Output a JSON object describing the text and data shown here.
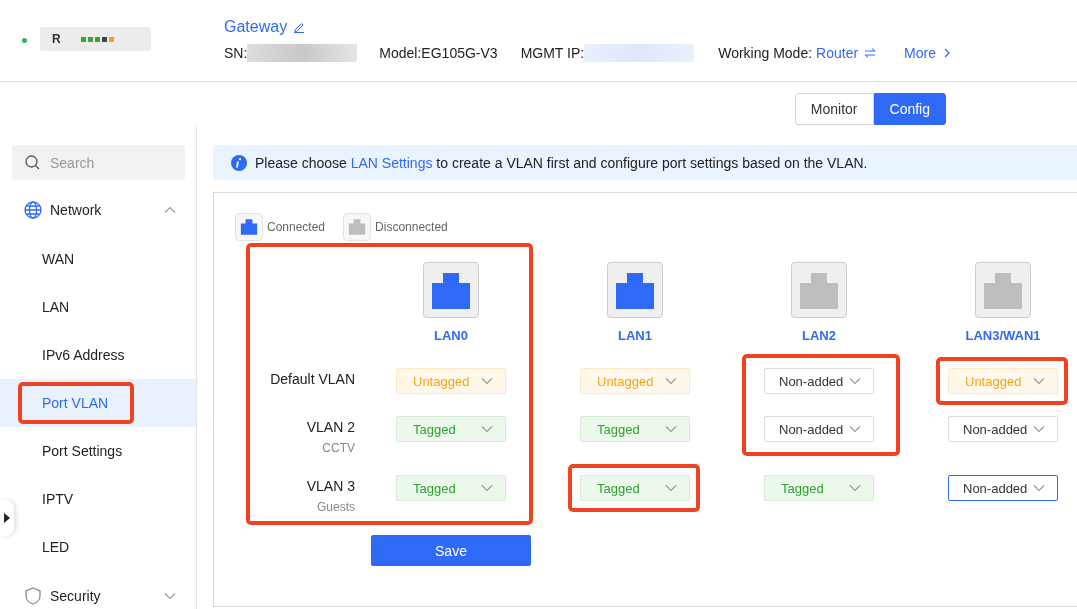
{
  "device": {
    "online": true,
    "label": "R",
    "name": "Gateway",
    "sn_label": "SN:",
    "model": "Model:EG105G-V3",
    "mgmt_ip_label": "MGMT IP:",
    "mode_label": "Working Mode:",
    "mode": "Router",
    "more": "More"
  },
  "view_tabs": [
    {
      "label": "Monitor",
      "selected": false
    },
    {
      "label": "Config",
      "selected": true
    }
  ],
  "sidebar": {
    "search": {
      "placeholder": "Search"
    },
    "groups": [
      {
        "label": "Network",
        "expanded": true,
        "children": [
          {
            "label": "WAN",
            "selected": false,
            "highlighted": false
          },
          {
            "label": "LAN",
            "selected": false,
            "highlighted": false
          },
          {
            "label": "IPv6 Address",
            "selected": false,
            "highlighted": false
          },
          {
            "label": "Port VLAN",
            "selected": true,
            "highlighted": true
          },
          {
            "label": "Port Settings",
            "selected": false,
            "highlighted": false
          },
          {
            "label": "IPTV",
            "selected": false,
            "highlighted": false
          },
          {
            "label": "LED",
            "selected": false,
            "highlighted": false
          }
        ]
      },
      {
        "label": "Security",
        "expanded": false
      }
    ]
  },
  "notice": {
    "before": "Please choose ",
    "link": "LAN Settings",
    "after": " to create a VLAN first and configure port settings based on the VLAN."
  },
  "legend": [
    {
      "label": "Connected",
      "connected": true
    },
    {
      "label": "Disconnected",
      "connected": false
    }
  ],
  "vlans": [
    {
      "name": "Default VLAN"
    },
    {
      "name": "VLAN 2",
      "description": "CCTV"
    },
    {
      "name": "VLAN 3",
      "description": "Guests"
    }
  ],
  "ports": [
    {
      "name": "LAN0",
      "connected": true,
      "highlighted": true,
      "cells": [
        {
          "value": "Untagged",
          "kind": "untagged",
          "highlighted": false,
          "focused": false
        },
        {
          "value": "Tagged",
          "kind": "tagged",
          "highlighted": false,
          "focused": false
        },
        {
          "value": "Tagged",
          "kind": "tagged",
          "highlighted": false,
          "focused": false
        }
      ]
    },
    {
      "name": "LAN1",
      "connected": true,
      "highlighted": false,
      "cells": [
        {
          "value": "Untagged",
          "kind": "untagged",
          "highlighted": false,
          "focused": false
        },
        {
          "value": "Tagged",
          "kind": "tagged",
          "highlighted": false,
          "focused": false
        },
        {
          "value": "Tagged",
          "kind": "tagged",
          "highlighted": true,
          "focused": false
        }
      ]
    },
    {
      "name": "LAN2",
      "connected": false,
      "highlighted": false,
      "cells": [
        {
          "value": "Non-added",
          "kind": "none",
          "highlighted": true,
          "focused": false
        },
        {
          "value": "Non-added",
          "kind": "none",
          "highlighted": true,
          "focused": false
        },
        {
          "value": "Tagged",
          "kind": "tagged",
          "highlighted": false,
          "focused": false
        }
      ]
    },
    {
      "name": "LAN3/WAN1",
      "connected": false,
      "highlighted": false,
      "cells": [
        {
          "value": "Untagged",
          "kind": "untagged",
          "highlighted": true,
          "focused": false
        },
        {
          "value": "Non-added",
          "kind": "none",
          "highlighted": false,
          "focused": false
        },
        {
          "value": "Non-added",
          "kind": "none",
          "highlighted": false,
          "focused": true
        }
      ]
    }
  ],
  "save": "Save"
}
